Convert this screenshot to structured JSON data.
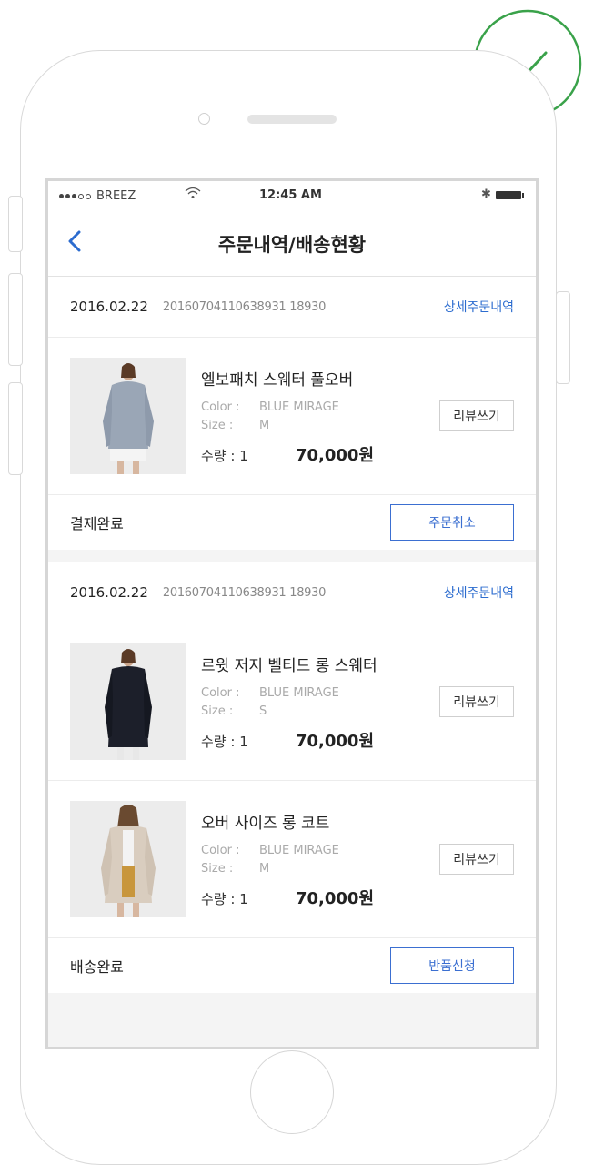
{
  "status_bar": {
    "carrier": "BREEZ",
    "time": "12:45 AM",
    "bluetooth_icon": "bluetooth-icon",
    "battery_icon": "battery-icon"
  },
  "nav": {
    "title": "주문내역/배송현황",
    "back_icon": "chevron-left-icon"
  },
  "colors": {
    "accent": "#3b6fd1",
    "link": "#2c6ccf",
    "badge_green": "#3aa24a"
  },
  "orders": [
    {
      "date": "2016.02.22",
      "order_no": "20160704110638931 18930",
      "detail_link": "상세주문내역",
      "items": [
        {
          "name": "엘보패치 스웨터 풀오버",
          "color_label": "Color :",
          "color_value": "BLUE MIRAGE",
          "size_label": "Size :",
          "size_value": "M",
          "qty_text": "수량 : 1",
          "price": "70,000원",
          "review_label": "리뷰쓰기"
        }
      ],
      "status": "결제완료",
      "action_label": "주문취소"
    },
    {
      "date": "2016.02.22",
      "order_no": "20160704110638931 18930",
      "detail_link": "상세주문내역",
      "items": [
        {
          "name": "르윗 저지 벨티드 롱 스웨터",
          "color_label": "Color :",
          "color_value": "BLUE MIRAGE",
          "size_label": "Size :",
          "size_value": "S",
          "qty_text": "수량 : 1",
          "price": "70,000원",
          "review_label": "리뷰쓰기"
        },
        {
          "name": "오버 사이즈 롱 코트",
          "color_label": "Color :",
          "color_value": "BLUE MIRAGE",
          "size_label": "Size :",
          "size_value": "M",
          "qty_text": "수량 : 1",
          "price": "70,000원",
          "review_label": "리뷰쓰기"
        }
      ],
      "status": "배송완료",
      "action_label": "반품신청"
    }
  ]
}
